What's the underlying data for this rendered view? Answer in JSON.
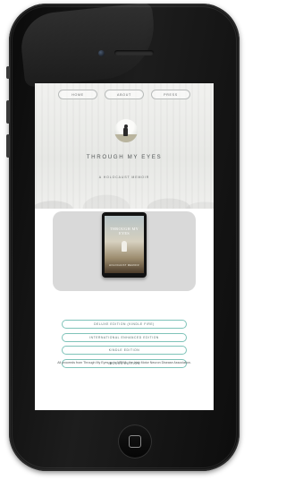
{
  "nav": {
    "items": [
      "HOME",
      "ABOUT",
      "PRESS"
    ]
  },
  "hero": {
    "title": "THROUGH MY EYES",
    "subtitle": "A HOLOCAUST MEMOIR"
  },
  "book": {
    "cover_title": "THROUGH MY EYES",
    "cover_author": "HOLOCAUST MEMOIR"
  },
  "editions": [
    "DELUXE EDITION (KINDLE FIRE)",
    "INTERNATIONAL ENHANCED EDITION",
    "KINDLE EDITION",
    "IBOOKS EDITION"
  ],
  "footer": {
    "proceeds": "All proceeds from Through My Eyes go to NRMA, the Irish Motor Neuron Disease Association."
  },
  "colors": {
    "accent": "#7fc3b9",
    "card": "#d9d9d9",
    "phone": "#111111"
  }
}
